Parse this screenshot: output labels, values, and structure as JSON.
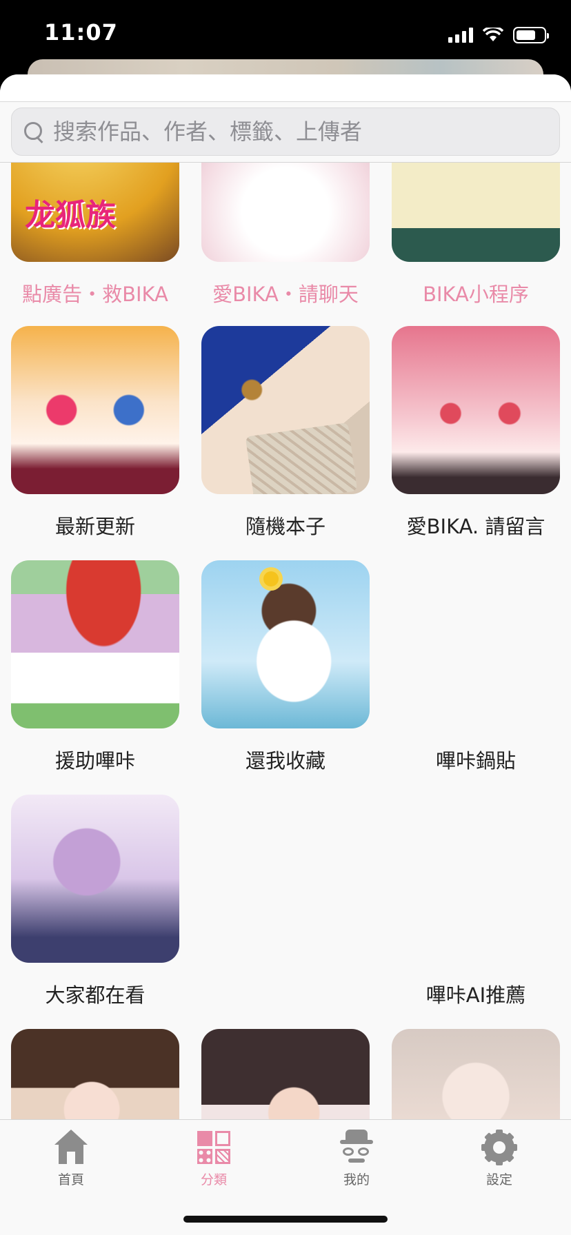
{
  "status_bar": {
    "time": "11:07"
  },
  "search": {
    "placeholder": "搜索作品、作者、標籤、上傳者"
  },
  "grid": {
    "row0": [
      "點廣告・救BIKA",
      "愛BIKA・請聊天",
      "BIKA小程序"
    ],
    "row1": [
      "最新更新",
      "隨機本子",
      "愛BIKA. 請留言"
    ],
    "row2": [
      "援助嗶咔",
      "還我收藏",
      "嗶咔鍋貼"
    ],
    "row3": [
      "大家都在看",
      "",
      "嗶咔AI推薦"
    ]
  },
  "tabbar": {
    "items": [
      "首頁",
      "分類",
      "我的",
      "設定"
    ],
    "active_index": 1
  },
  "colors": {
    "accent_pink": "#e98aa8",
    "icon_gray": "#8c8c8c"
  },
  "icons": [
    "search-icon",
    "home-icon",
    "category-icon",
    "profile-icon",
    "gear-icon"
  ]
}
